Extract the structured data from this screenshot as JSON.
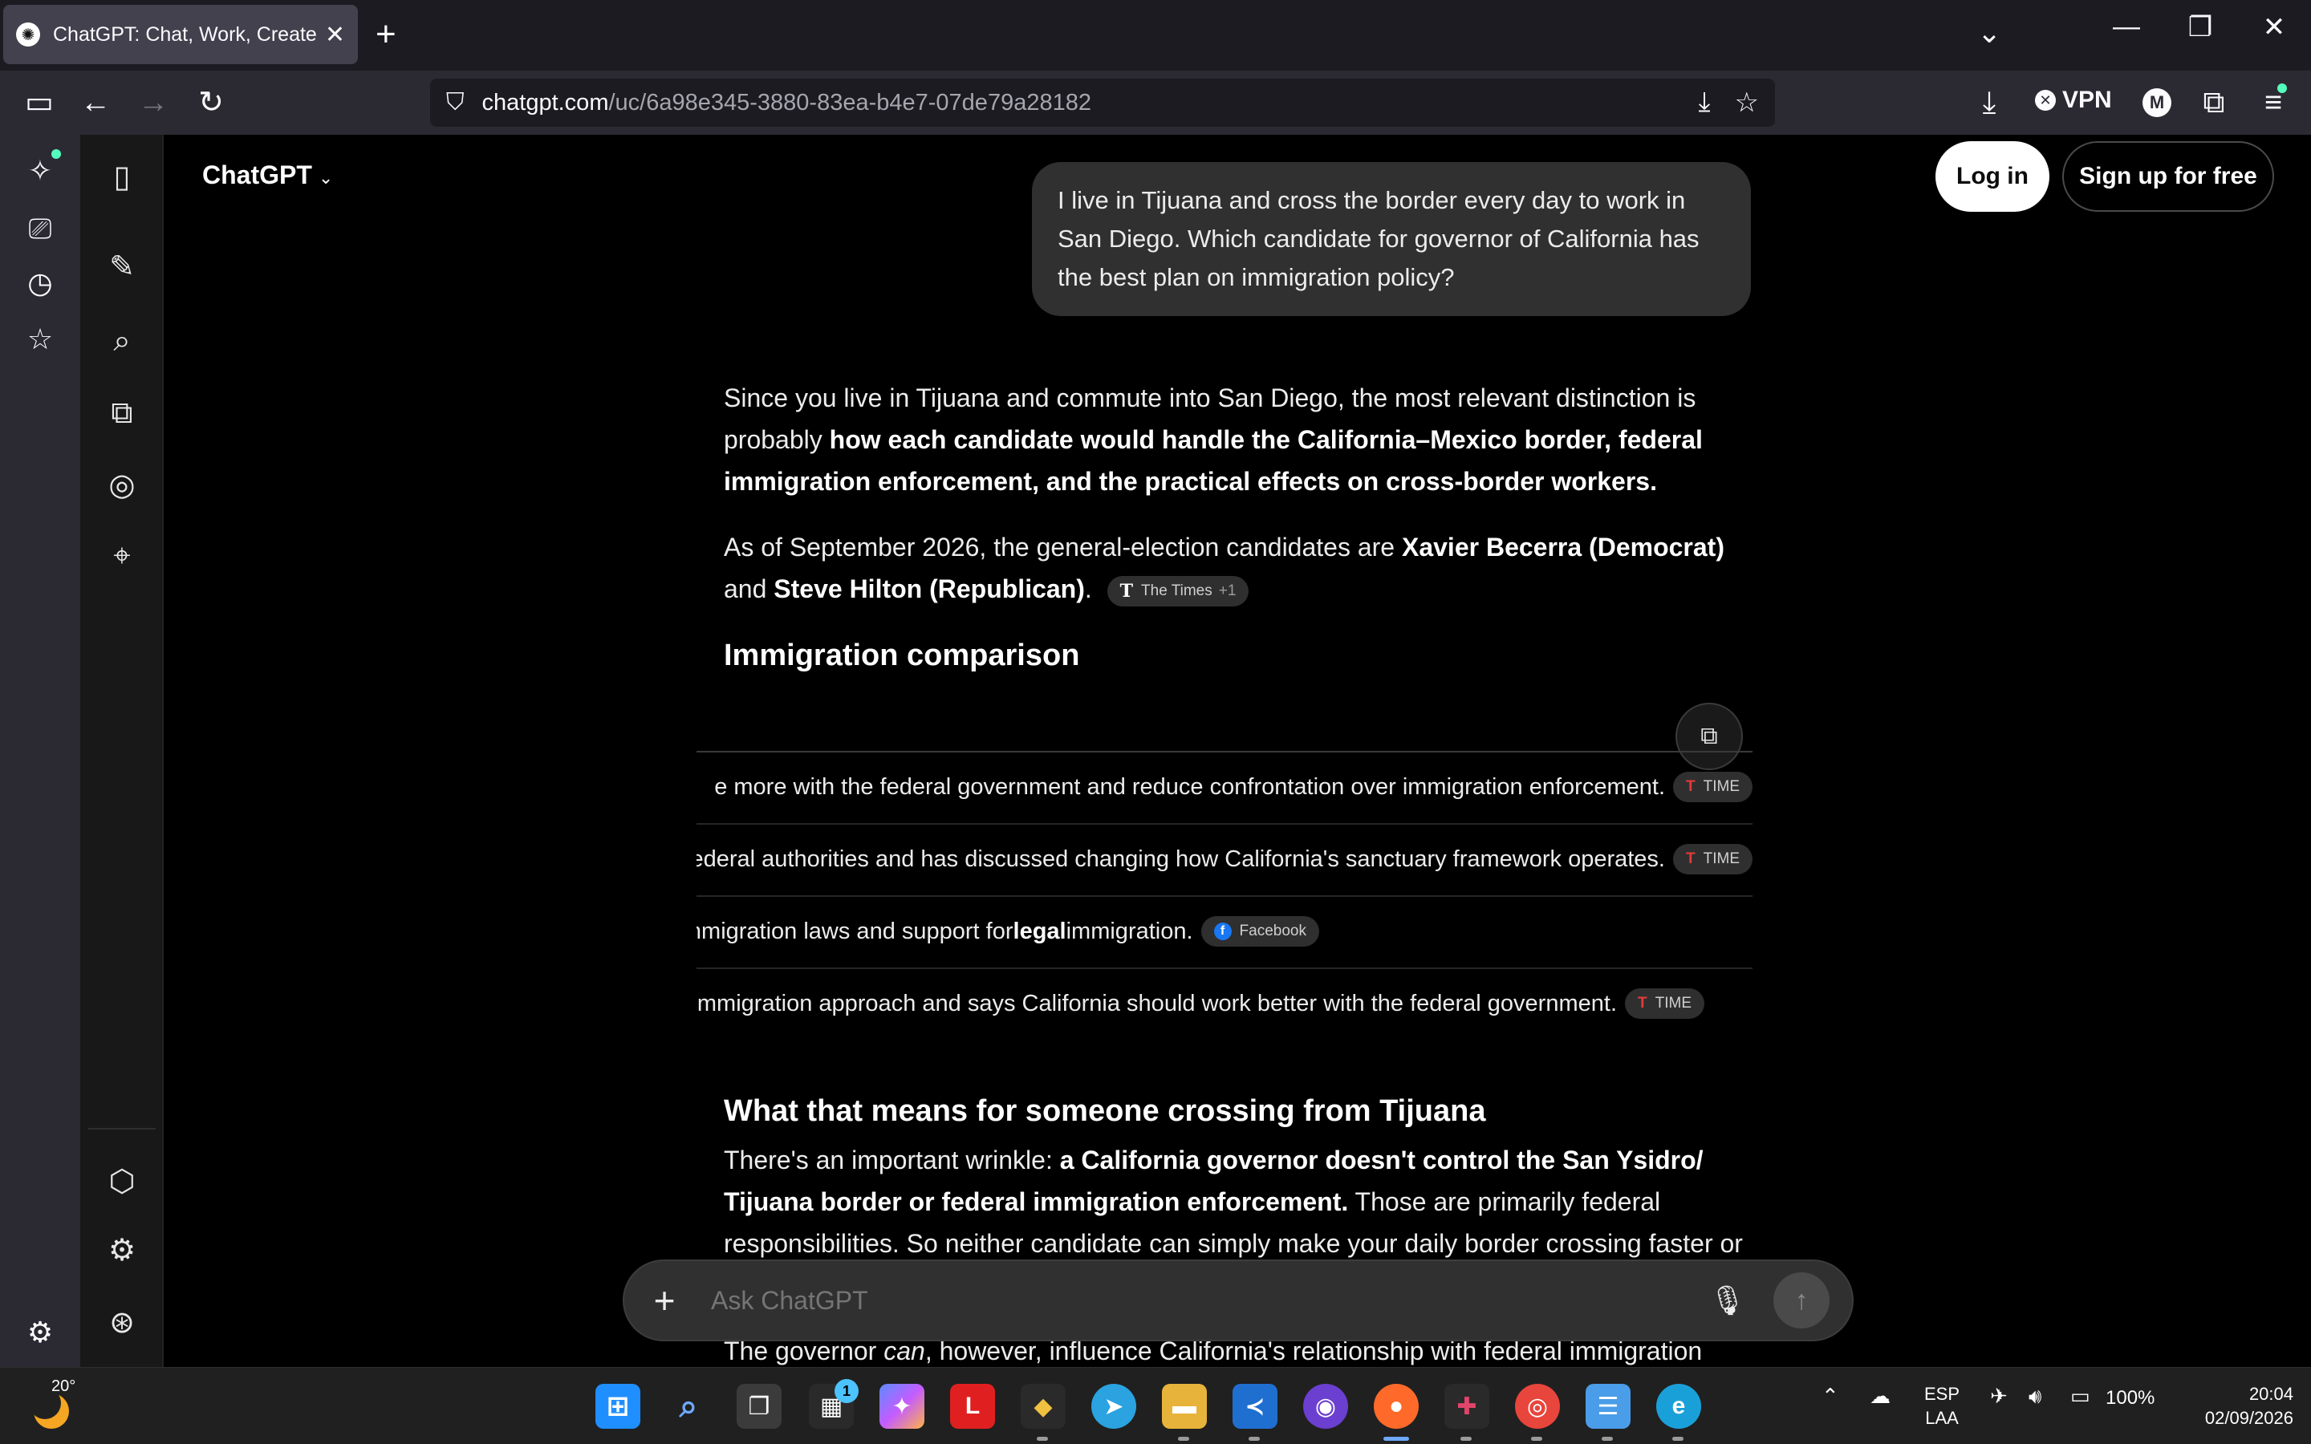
{
  "browser": {
    "tab_title": "ChatGPT: Chat, Work, Create &",
    "url_host": "chatgpt.com",
    "url_path": "/uc/6a98e345-3880-83ea-b4e7-07de79a28182",
    "vpn_label": "VPN",
    "account_initial": "M"
  },
  "app": {
    "brand": "ChatGPT",
    "login_label": "Log in",
    "signup_label": "Sign up for free"
  },
  "conversation": {
    "user_message": "I live in Tijuana and cross the border every day to work in San Diego. Which candidate for governor of California has the best plan on immigration policy?",
    "p1_a": "Since you live in Tijuana and commute into San Diego, the most relevant distinction is probably ",
    "p1_b": "how each candidate would handle the California–Mexico border, federal immigration enforcement, and the practical effects on cross-border workers.",
    "p2_a": "As of September 2026, the general-election candidates are ",
    "p2_b": "Xavier Becerra (Democrat)",
    "p2_c": " and ",
    "p2_d": "Steve Hilton (Republican)",
    "p2_e": ".",
    "p2_cite": "The Times",
    "p2_cite_more": "+1",
    "heading_comparison": "Immigration comparison",
    "rows": [
      {
        "text": "e more with the federal government and reduce confrontation over immigration enforcement.",
        "source": "TIME"
      },
      {
        "text": "th federal authorities and has discussed changing how California's sanctuary framework operates.",
        "source": "TIME"
      },
      {
        "text_a": "nmigration laws and support for ",
        "text_b": "legal",
        "text_c": " immigration.",
        "source": "Facebook"
      },
      {
        "text": "np's immigration approach and says California should work better with the federal government.",
        "source": "TIME"
      }
    ],
    "heading_means": "What that means for someone crossing from Tijuana",
    "p3_a": "There's an important wrinkle: ",
    "p3_b": "a California governor doesn't control the San Ysidro/ Tijuana border or federal immigration enforcement.",
    "p3_c": " Those are primarily federal responsibilities. So neither candidate can simply make your daily border crossing faster or",
    "p4_a": "The governor ",
    "p4_b": "can",
    "p4_c": ", however, influence California's relationship with federal immigration"
  },
  "composer": {
    "placeholder": "Ask ChatGPT"
  },
  "taskbar": {
    "temperature": "20°",
    "store_badge": "1",
    "lang_top": "ESP",
    "lang_bottom": "LAA",
    "battery": "100%",
    "time": "20:04",
    "date": "02/09/2026"
  },
  "colors": {
    "background": "#000000",
    "bubble": "#303030",
    "chrome": "#2b2a33",
    "accent_new": "#54ffbd"
  }
}
